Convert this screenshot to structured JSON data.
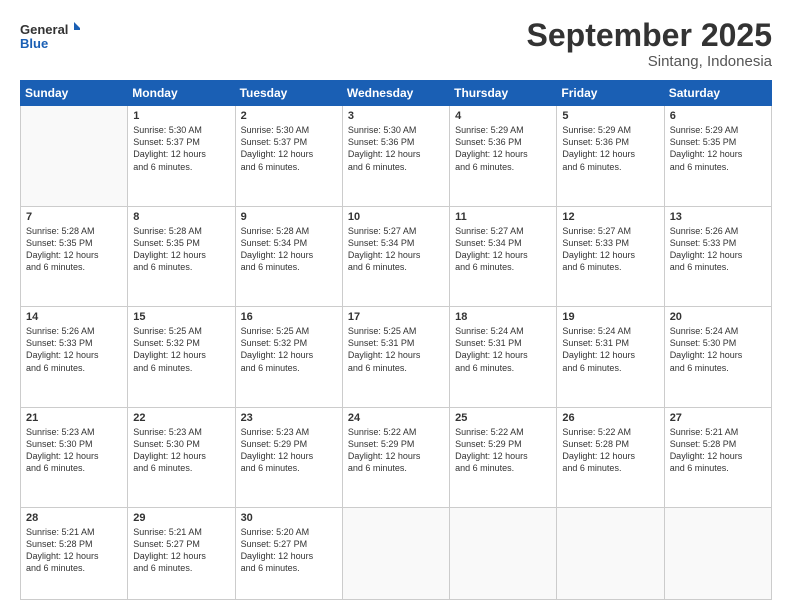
{
  "logo": {
    "line1": "General",
    "line2": "Blue"
  },
  "title": "September 2025",
  "subtitle": "Sintang, Indonesia",
  "days_of_week": [
    "Sunday",
    "Monday",
    "Tuesday",
    "Wednesday",
    "Thursday",
    "Friday",
    "Saturday"
  ],
  "weeks": [
    [
      {
        "day": "",
        "info": ""
      },
      {
        "day": "1",
        "info": "Sunrise: 5:30 AM\nSunset: 5:37 PM\nDaylight: 12 hours\nand 6 minutes."
      },
      {
        "day": "2",
        "info": "Sunrise: 5:30 AM\nSunset: 5:37 PM\nDaylight: 12 hours\nand 6 minutes."
      },
      {
        "day": "3",
        "info": "Sunrise: 5:30 AM\nSunset: 5:36 PM\nDaylight: 12 hours\nand 6 minutes."
      },
      {
        "day": "4",
        "info": "Sunrise: 5:29 AM\nSunset: 5:36 PM\nDaylight: 12 hours\nand 6 minutes."
      },
      {
        "day": "5",
        "info": "Sunrise: 5:29 AM\nSunset: 5:36 PM\nDaylight: 12 hours\nand 6 minutes."
      },
      {
        "day": "6",
        "info": "Sunrise: 5:29 AM\nSunset: 5:35 PM\nDaylight: 12 hours\nand 6 minutes."
      }
    ],
    [
      {
        "day": "7",
        "info": "Sunrise: 5:28 AM\nSunset: 5:35 PM\nDaylight: 12 hours\nand 6 minutes."
      },
      {
        "day": "8",
        "info": "Sunrise: 5:28 AM\nSunset: 5:35 PM\nDaylight: 12 hours\nand 6 minutes."
      },
      {
        "day": "9",
        "info": "Sunrise: 5:28 AM\nSunset: 5:34 PM\nDaylight: 12 hours\nand 6 minutes."
      },
      {
        "day": "10",
        "info": "Sunrise: 5:27 AM\nSunset: 5:34 PM\nDaylight: 12 hours\nand 6 minutes."
      },
      {
        "day": "11",
        "info": "Sunrise: 5:27 AM\nSunset: 5:34 PM\nDaylight: 12 hours\nand 6 minutes."
      },
      {
        "day": "12",
        "info": "Sunrise: 5:27 AM\nSunset: 5:33 PM\nDaylight: 12 hours\nand 6 minutes."
      },
      {
        "day": "13",
        "info": "Sunrise: 5:26 AM\nSunset: 5:33 PM\nDaylight: 12 hours\nand 6 minutes."
      }
    ],
    [
      {
        "day": "14",
        "info": "Sunrise: 5:26 AM\nSunset: 5:33 PM\nDaylight: 12 hours\nand 6 minutes."
      },
      {
        "day": "15",
        "info": "Sunrise: 5:25 AM\nSunset: 5:32 PM\nDaylight: 12 hours\nand 6 minutes."
      },
      {
        "day": "16",
        "info": "Sunrise: 5:25 AM\nSunset: 5:32 PM\nDaylight: 12 hours\nand 6 minutes."
      },
      {
        "day": "17",
        "info": "Sunrise: 5:25 AM\nSunset: 5:31 PM\nDaylight: 12 hours\nand 6 minutes."
      },
      {
        "day": "18",
        "info": "Sunrise: 5:24 AM\nSunset: 5:31 PM\nDaylight: 12 hours\nand 6 minutes."
      },
      {
        "day": "19",
        "info": "Sunrise: 5:24 AM\nSunset: 5:31 PM\nDaylight: 12 hours\nand 6 minutes."
      },
      {
        "day": "20",
        "info": "Sunrise: 5:24 AM\nSunset: 5:30 PM\nDaylight: 12 hours\nand 6 minutes."
      }
    ],
    [
      {
        "day": "21",
        "info": "Sunrise: 5:23 AM\nSunset: 5:30 PM\nDaylight: 12 hours\nand 6 minutes."
      },
      {
        "day": "22",
        "info": "Sunrise: 5:23 AM\nSunset: 5:30 PM\nDaylight: 12 hours\nand 6 minutes."
      },
      {
        "day": "23",
        "info": "Sunrise: 5:23 AM\nSunset: 5:29 PM\nDaylight: 12 hours\nand 6 minutes."
      },
      {
        "day": "24",
        "info": "Sunrise: 5:22 AM\nSunset: 5:29 PM\nDaylight: 12 hours\nand 6 minutes."
      },
      {
        "day": "25",
        "info": "Sunrise: 5:22 AM\nSunset: 5:29 PM\nDaylight: 12 hours\nand 6 minutes."
      },
      {
        "day": "26",
        "info": "Sunrise: 5:22 AM\nSunset: 5:28 PM\nDaylight: 12 hours\nand 6 minutes."
      },
      {
        "day": "27",
        "info": "Sunrise: 5:21 AM\nSunset: 5:28 PM\nDaylight: 12 hours\nand 6 minutes."
      }
    ],
    [
      {
        "day": "28",
        "info": "Sunrise: 5:21 AM\nSunset: 5:28 PM\nDaylight: 12 hours\nand 6 minutes."
      },
      {
        "day": "29",
        "info": "Sunrise: 5:21 AM\nSunset: 5:27 PM\nDaylight: 12 hours\nand 6 minutes."
      },
      {
        "day": "30",
        "info": "Sunrise: 5:20 AM\nSunset: 5:27 PM\nDaylight: 12 hours\nand 6 minutes."
      },
      {
        "day": "",
        "info": ""
      },
      {
        "day": "",
        "info": ""
      },
      {
        "day": "",
        "info": ""
      },
      {
        "day": "",
        "info": ""
      }
    ]
  ]
}
